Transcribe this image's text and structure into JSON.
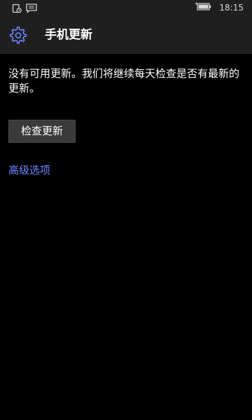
{
  "status_bar": {
    "time": "18:15",
    "icons": [
      "notification-icon",
      "message-icon",
      "battery-icon"
    ]
  },
  "header": {
    "title": "手机更新",
    "icon": "gear-icon"
  },
  "main": {
    "message": "没有可用更新。我们将继续每天检查是否有最新的更新。",
    "check_button_label": "检查更新",
    "advanced_options_label": "高级选项"
  },
  "colors": {
    "accent": "#6f86ff",
    "background": "#000000",
    "header_background": "#1f1f1f",
    "button_background": "#3a3a3a"
  }
}
